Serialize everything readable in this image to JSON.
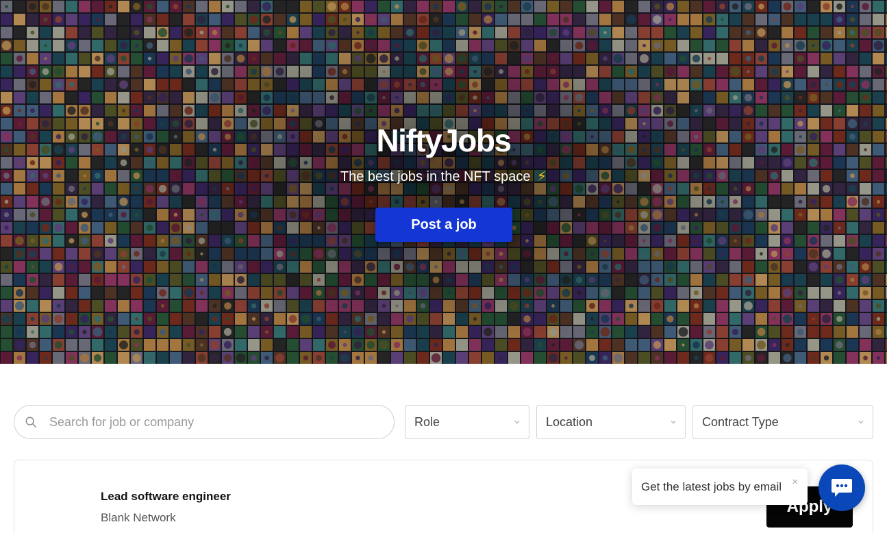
{
  "hero": {
    "title": "NiftyJobs",
    "subtitle": "The best jobs in the NFT space",
    "subtitle_icon": "lightning-bolt-icon",
    "post_button": "Post a job",
    "accent_color": "#1436d4"
  },
  "filters": {
    "search_placeholder": "Search for job or company",
    "search_value": "",
    "role": "Role",
    "location": "Location",
    "contract_type": "Contract Type"
  },
  "jobs": [
    {
      "title": "Lead software engineer",
      "company": "Blank Network",
      "apply_label": "Apply"
    }
  ],
  "email_popup": {
    "text": "Get the latest jobs by email",
    "close": "×"
  },
  "chat": {
    "icon": "chat-bubble-icon",
    "color": "#0a47b8"
  }
}
